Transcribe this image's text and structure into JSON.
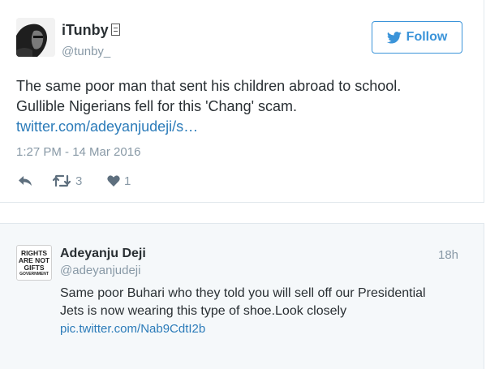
{
  "tweet": {
    "display_name": "iTunby",
    "handle": "@tunby_",
    "follow_label": "Follow",
    "text_line1": "The same poor man that sent his children abroad to school.",
    "text_line2": "Gullible Nigerians fell for this 'Chang' scam.",
    "link": "twitter.com/adeyanjudeji/s…",
    "timestamp": "1:27 PM - 14 Mar 2016",
    "retweet_count": "3",
    "like_count": "1",
    "icons": [
      "reply-icon",
      "retweet-icon",
      "heart-icon",
      "twitter-bird-icon"
    ],
    "colors": {
      "link": "#2b7bb9",
      "follow": "#3b94d9",
      "muted": "#8899a6"
    }
  },
  "quoted_tweet": {
    "display_name": "Adeyanju Deji",
    "handle": "@adeyanjudeji",
    "time_ago": "18h",
    "text_line1": "Same poor Buhari who they told you will sell off our Presidential",
    "text_line2": "Jets is now wearing this type of shoe.Look closely",
    "link": "pic.twitter.com/Nab9CdtI2b",
    "avatar_text": [
      "RIGHTS",
      "ARE NOT",
      "GIFTS",
      "GOVERNMENT"
    ],
    "background": "#f5f8fa"
  }
}
